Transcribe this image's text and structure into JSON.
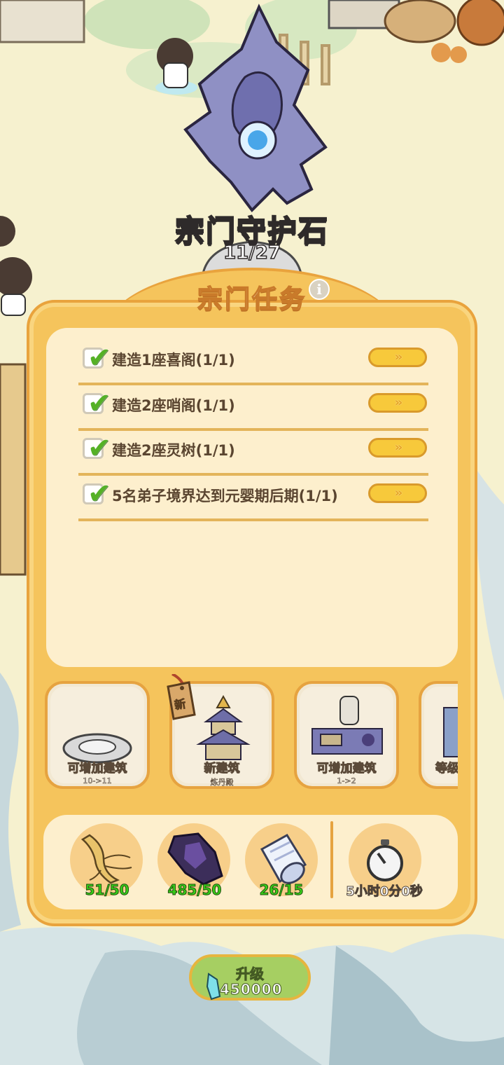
{
  "guardian": {
    "title": "宗门守护石",
    "progress": "11/27"
  },
  "panel": {
    "title": "宗门任务",
    "info_icon": "i"
  },
  "tasks": [
    {
      "text": "建造1座喜阁(1/1)",
      "done": true,
      "go": "»"
    },
    {
      "text": "建造2座哨阁(1/1)",
      "done": true,
      "go": "»"
    },
    {
      "text": "建造2座灵树(1/1)",
      "done": true,
      "go": "»"
    },
    {
      "text": "5名弟子境界达到元婴期后期(1/1)",
      "done": true,
      "go": "»"
    }
  ],
  "buildings": [
    {
      "label": "可增加建筑",
      "sub": "10->11",
      "icon": "guardian-stone-icon"
    },
    {
      "label": "新建筑",
      "sub": "炼丹殿",
      "icon": "alchemy-hall-icon",
      "tag": "新"
    },
    {
      "label": "可增加建筑",
      "sub": "1->2",
      "icon": "workshop-icon"
    },
    {
      "label": "等级",
      "sub": "",
      "icon": "tower-icon"
    }
  ],
  "resources": [
    {
      "name": "ginseng-icon",
      "count": "51/50"
    },
    {
      "name": "dark-crystal-icon",
      "count": "485/50"
    },
    {
      "name": "silk-scroll-icon",
      "count": "26/15"
    }
  ],
  "timer": {
    "icon": "stopwatch-icon",
    "text": "5小时0分0秒"
  },
  "upgrade": {
    "label": "升级",
    "cost": "450000",
    "icon": "spirit-crystal-icon"
  },
  "colors": {
    "panel": "#f5c45c",
    "panel_border": "#e9a33d",
    "task_bg": "#fdefcd",
    "resource_ok": "#38d019",
    "upgrade_btn": "#a6cf62"
  }
}
